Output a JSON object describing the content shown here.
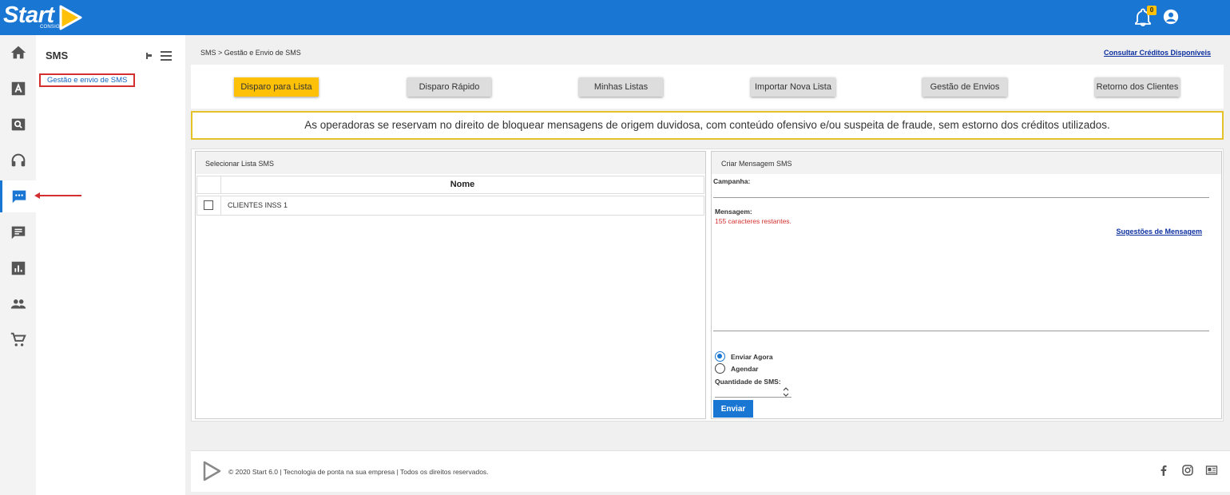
{
  "app": {
    "logo_text": "Start",
    "logo_sub": "CONSIG"
  },
  "header": {
    "notifications_count": "0"
  },
  "sidebar": {
    "title": "SMS",
    "link": "Gestão e envio de SMS",
    "rail_icons": [
      "home-icon",
      "font-icon",
      "search-icon",
      "headset-icon",
      "chat-dots-icon",
      "message-icon",
      "chart-icon",
      "people-icon",
      "cart-icon"
    ],
    "active_index": 4
  },
  "breadcrumb": "SMS > Gestão e Envio de SMS",
  "credits_link": "Consultar Créditos Disponíveis",
  "tabs": [
    {
      "label": "Disparo para Lista",
      "active": true
    },
    {
      "label": "Disparo Rápido",
      "active": false
    },
    {
      "label": "Minhas Listas",
      "active": false
    },
    {
      "label": "Importar Nova Lista",
      "active": false
    },
    {
      "label": "Gestão de Envios",
      "active": false
    },
    {
      "label": "Retorno dos Clientes",
      "active": false
    }
  ],
  "warning": "As operadoras se reservam no direito de bloquear mensagens de origem duvidosa, com conteúdo ofensivo e/ou suspeita de fraude, sem estorno dos créditos utilizados.",
  "list_panel": {
    "title": "Selecionar Lista SMS",
    "column_name": "Nome",
    "rows": [
      "CLIENTES INSS 1"
    ]
  },
  "message_panel": {
    "title": "Criar Mensagem SMS",
    "campaign_label": "Campanha:",
    "message_label": "Mensagem:",
    "chars_remaining": "155 caracteres restantes.",
    "suggestions_link": "Sugestões de Mensagem",
    "send_now_label": "Enviar Agora",
    "schedule_label": "Agendar",
    "quantity_label": "Quantidade de SMS:",
    "send_button": "Enviar"
  },
  "footer": {
    "text": "© 2020 Start 6.0 | Tecnologia de ponta na sua empresa | Todos os direitos reservados."
  },
  "colors": {
    "primary": "#1976d2",
    "accent": "#ffc107",
    "alert_red": "#d32f2f"
  }
}
